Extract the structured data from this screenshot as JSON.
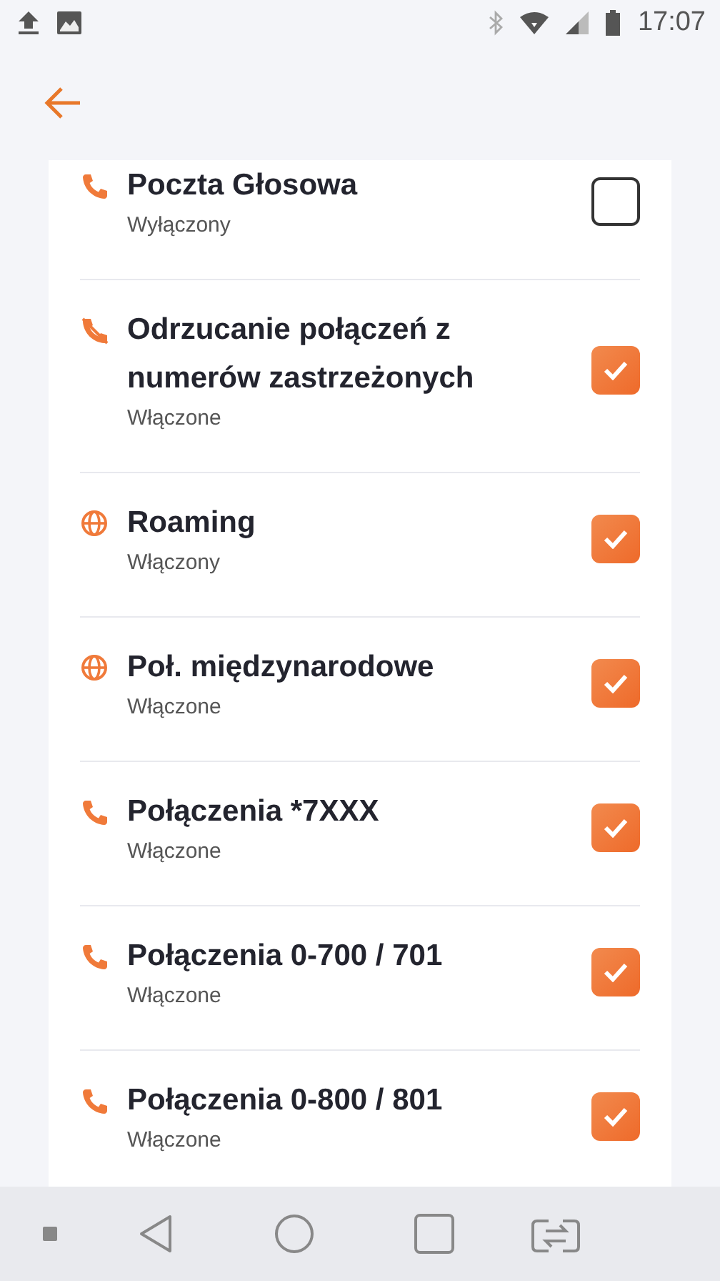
{
  "status_bar": {
    "time": "17:07"
  },
  "settings": [
    {
      "kind": "phone",
      "title": "Poczta Głosowa",
      "status": "Wyłączony",
      "checked": false
    },
    {
      "kind": "blocked",
      "title": "Odrzucanie połączeń z numerów zastrzeżonych",
      "status": "Włączone",
      "checked": true
    },
    {
      "kind": "globe",
      "title": "Roaming",
      "status": "Włączony",
      "checked": true
    },
    {
      "kind": "globe",
      "title": "Poł. międzynarodowe",
      "status": "Włączone",
      "checked": true
    },
    {
      "kind": "phone",
      "title": "Połączenia *7XXX",
      "status": "Włączone",
      "checked": true
    },
    {
      "kind": "phone",
      "title": "Połączenia 0-700 / 701",
      "status": "Włączone",
      "checked": true
    },
    {
      "kind": "phone",
      "title": "Połączenia 0-800 / 801",
      "status": "Włączone",
      "checked": true
    }
  ]
}
